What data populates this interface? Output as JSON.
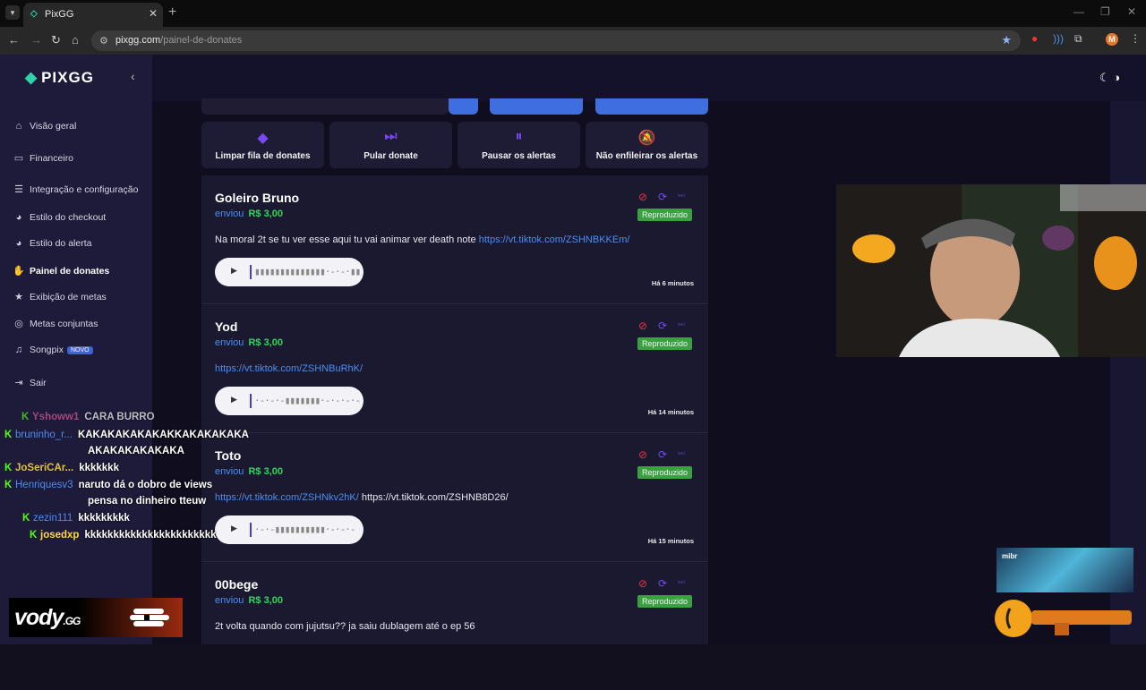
{
  "browser": {
    "tab_title": "PixGG",
    "url_domain": "pixgg.com",
    "url_path": "/painel-de-donates",
    "profile_initial": "M"
  },
  "app": {
    "brand": "PIXGG",
    "sidebar": [
      {
        "label": "Visão geral",
        "icon": "home-icon"
      },
      {
        "label": "Financeiro",
        "icon": "wallet-icon"
      },
      {
        "label": "Integração e configuração",
        "icon": "settings-icon"
      },
      {
        "label": "Estilo do checkout",
        "icon": "palette-icon"
      },
      {
        "label": "Estilo do alerta",
        "icon": "palette-icon"
      },
      {
        "label": "Painel de donates",
        "icon": "donate-icon",
        "active": true
      },
      {
        "label": "Exibição de metas",
        "icon": "star-icon"
      },
      {
        "label": "Metas conjuntas",
        "icon": "target-icon"
      },
      {
        "label": "Songpix",
        "icon": "music-icon",
        "badge": "NOVO"
      },
      {
        "label": "Sair",
        "icon": "logout-icon"
      }
    ],
    "actions": [
      {
        "label": "Limpar fila de donates",
        "icon": "eraser-icon"
      },
      {
        "label": "Pular donate",
        "icon": "skip-icon"
      },
      {
        "label": "Pausar os alertas",
        "icon": "pause-icon"
      },
      {
        "label": "Não enfileirar os alertas",
        "icon": "bell-off-icon"
      }
    ],
    "sent_label": "enviou",
    "donations": [
      {
        "name": "Goleiro Bruno",
        "amount": "R$ 3,00",
        "status": "Reproduzido",
        "message_text": "Na moral 2t se tu ver esse aqui tu vai animar ver death note ",
        "message_link": "https://vt.tiktok.com/ZSHNBKKEm/",
        "message_tail": "",
        "time": "Há 6 minutos"
      },
      {
        "name": "Yod",
        "amount": "R$ 3,00",
        "status": "Reproduzido",
        "message_text": "",
        "message_link": "https://vt.tiktok.com/ZSHNBuRhK/",
        "message_tail": "",
        "time": "Há 14 minutos"
      },
      {
        "name": "Toto",
        "amount": "R$ 3,00",
        "status": "Reproduzido",
        "message_text": "",
        "message_link": "https://vt.tiktok.com/ZSHNkv2hK/",
        "message_tail": " https://vt.tiktok.com/ZSHNB8D26/",
        "time": "Há 15 minutos"
      },
      {
        "name": "00bege",
        "amount": "R$ 3,00",
        "status": "Reproduzido",
        "message_text": "2t volta quando com jujutsu?? ja saiu dublagem até o ep 56",
        "message_link": "",
        "message_tail": "",
        "time": ""
      }
    ]
  },
  "chat": [
    {
      "user": "Yshoww1",
      "text": "CARA BURRO",
      "color": "#e05a9a"
    },
    {
      "user": "bruninho_r...",
      "text": "KAKAKAKAKAKAKKAKAKAKAKA",
      "color": "#4c8ef0"
    },
    {
      "user": "",
      "text": "AKAKAKAKAKAKA",
      "color": "#ffffff"
    },
    {
      "user": "JoSeriCAr...",
      "text": "kkkkkkk",
      "color": "#e0c040"
    },
    {
      "user": "Henriquesv3",
      "text": "naruto dá o dobro de views",
      "color": "#4c8ef0"
    },
    {
      "user": "",
      "text": "pensa no dinheiro tteuw",
      "color": "#ffffff"
    },
    {
      "user": "zezin111",
      "text": "kkkkkkkkk",
      "color": "#4c8ef0"
    },
    {
      "user": "josedxp",
      "text": "kkkkkkkkkkkkkkkkkkkkkkk",
      "color": "#ffd93b"
    }
  ],
  "overlay": {
    "vody_brand": "vody",
    "vody_suffix": ".GG",
    "sponsor_tag": "mibr"
  }
}
